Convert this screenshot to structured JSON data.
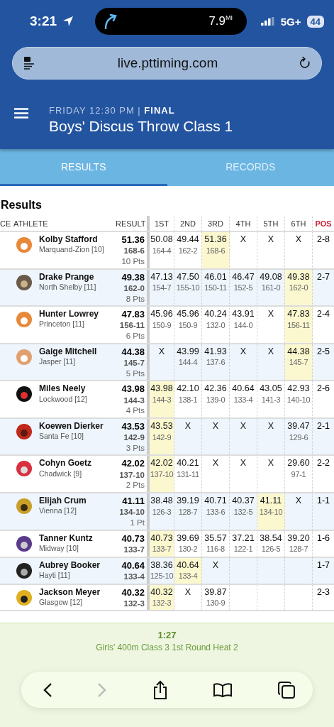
{
  "status_bar": {
    "time": "3:21",
    "activity": "7.9$^{MI}$",
    "network": "5G+",
    "battery": "44"
  },
  "browser": {
    "url": "live.pttiming.com"
  },
  "header": {
    "subtitle": "FRIDAY 12:30 PM | **FINAL**",
    "title": "Boys' Discus Throw Class 1"
  },
  "tabs": [
    {
      "label": "RESULTS",
      "selected": true
    },
    {
      "label": "RECORDS",
      "selected": false
    }
  ],
  "section_title": "Results",
  "table": {
    "columns": [
      {
        "label": "CE",
        "kind": "place"
      },
      {
        "label": "ATHLETE",
        "kind": "athlete"
      },
      {
        "label": "RESULT",
        "kind": "result"
      },
      {
        "label": "1ST",
        "kind": "attempt"
      },
      {
        "label": "2ND",
        "kind": "attempt"
      },
      {
        "label": "3RD",
        "kind": "attempt"
      },
      {
        "label": "4TH",
        "kind": "attempt"
      },
      {
        "label": "5TH",
        "kind": "attempt"
      },
      {
        "label": "6TH",
        "kind": "attempt"
      },
      {
        "label": "POS",
        "kind": "position"
      }
    ],
    "rows": [
      {
        "name": "Kolby Stafford",
        "school": "Marquand-Zion [10]",
        "mark": "51.36",
        "feet": "168-6",
        "points": "10 Pts",
        "attempts": [
          {
            "mark": "50.08",
            "feet": "164-4",
            "best": false
          },
          {
            "mark": "49.44",
            "feet": "162-2",
            "best": false
          },
          {
            "mark": "51.36",
            "feet": "168-6",
            "best": true
          },
          {
            "mark": "X",
            "best": false
          },
          {
            "mark": "X",
            "best": false
          },
          {
            "mark": "X",
            "best": false
          }
        ],
        "pos": "2-8"
      },
      {
        "name": "Drake Prange",
        "school": "North Shelby [11]",
        "mark": "49.38",
        "feet": "162-0",
        "points": "8 Pts",
        "attempts": [
          {
            "mark": "47.13",
            "feet": "154-7",
            "best": false
          },
          {
            "mark": "47.50",
            "feet": "155-10",
            "best": false
          },
          {
            "mark": "46.01",
            "feet": "150-11",
            "best": false
          },
          {
            "mark": "46.47",
            "feet": "152-5",
            "best": false
          },
          {
            "mark": "49.08",
            "feet": "161-0",
            "best": false
          },
          {
            "mark": "49.38",
            "feet": "162-0",
            "best": true
          }
        ],
        "pos": "2-7"
      },
      {
        "name": "Hunter Lowrey",
        "school": "Princeton [11]",
        "mark": "47.83",
        "feet": "156-11",
        "points": "6 Pts",
        "attempts": [
          {
            "mark": "45.96",
            "feet": "150-9",
            "best": false
          },
          {
            "mark": "45.96",
            "feet": "150-9",
            "best": false
          },
          {
            "mark": "40.24",
            "feet": "132-0",
            "best": false
          },
          {
            "mark": "43.91",
            "feet": "144-0",
            "best": false
          },
          {
            "mark": "X",
            "best": false
          },
          {
            "mark": "47.83",
            "feet": "156-11",
            "best": true
          }
        ],
        "pos": "2-4"
      },
      {
        "name": "Gaige Mitchell",
        "school": "Jasper [11]",
        "mark": "44.38",
        "feet": "145-7",
        "points": "5 Pts",
        "attempts": [
          {
            "mark": "X",
            "best": false
          },
          {
            "mark": "43.99",
            "feet": "144-4",
            "best": false
          },
          {
            "mark": "41.93",
            "feet": "137-6",
            "best": false
          },
          {
            "mark": "X",
            "best": false
          },
          {
            "mark": "X",
            "best": false
          },
          {
            "mark": "44.38",
            "feet": "145-7",
            "best": true
          }
        ],
        "pos": "2-5"
      },
      {
        "name": "Miles Neely",
        "school": "Lockwood [12]",
        "mark": "43.98",
        "feet": "144-3",
        "points": "4 Pts",
        "attempts": [
          {
            "mark": "43.98",
            "feet": "144-3",
            "best": true
          },
          {
            "mark": "42.10",
            "feet": "138-1",
            "best": false
          },
          {
            "mark": "42.36",
            "feet": "139-0",
            "best": false
          },
          {
            "mark": "40.64",
            "feet": "133-4",
            "best": false
          },
          {
            "mark": "43.05",
            "feet": "141-3",
            "best": false
          },
          {
            "mark": "42.93",
            "feet": "140-10",
            "best": false
          }
        ],
        "pos": "2-6"
      },
      {
        "name": "Koewen Dierker",
        "school": "Santa Fe [10]",
        "mark": "43.53",
        "feet": "142-9",
        "points": "3 Pts",
        "attempts": [
          {
            "mark": "43.53",
            "feet": "142-9",
            "best": true
          },
          {
            "mark": "X",
            "best": false
          },
          {
            "mark": "X",
            "best": false
          },
          {
            "mark": "X",
            "best": false
          },
          {
            "mark": "X",
            "best": false
          },
          {
            "mark": "39.47",
            "feet": "129-6",
            "best": false
          }
        ],
        "pos": "2-1"
      },
      {
        "name": "Cohyn Goetz",
        "school": "Chadwick [9]",
        "mark": "42.02",
        "feet": "137-10",
        "points": "2 Pts",
        "attempts": [
          {
            "mark": "42.02",
            "feet": "137-10",
            "best": true
          },
          {
            "mark": "40.21",
            "feet": "131-11",
            "best": false
          },
          {
            "mark": "X",
            "best": false
          },
          {
            "mark": "X",
            "best": false
          },
          {
            "mark": "X",
            "best": false
          },
          {
            "mark": "29.60",
            "feet": "97-1",
            "best": false
          }
        ],
        "pos": "2-2"
      },
      {
        "name": "Elijah Crum",
        "school": "Vienna [12]",
        "mark": "41.11",
        "feet": "134-10",
        "points": "1 Pt",
        "attempts": [
          {
            "mark": "38.48",
            "feet": "126-3",
            "best": false
          },
          {
            "mark": "39.19",
            "feet": "128-7",
            "best": false
          },
          {
            "mark": "40.71",
            "feet": "133-6",
            "best": false
          },
          {
            "mark": "40.37",
            "feet": "132-5",
            "best": false
          },
          {
            "mark": "41.11",
            "feet": "134-10",
            "best": true
          },
          {
            "mark": "X",
            "best": false
          }
        ],
        "pos": "1-1"
      },
      {
        "name": "Tanner Kuntz",
        "school": "Midway [10]",
        "mark": "40.73",
        "feet": "133-7",
        "attempts": [
          {
            "mark": "40.73",
            "feet": "133-7",
            "best": true
          },
          {
            "mark": "39.69",
            "feet": "130-2",
            "best": false
          },
          {
            "mark": "35.57",
            "feet": "116-8",
            "best": false
          },
          {
            "mark": "37.21",
            "feet": "122-1",
            "best": false
          },
          {
            "mark": "38.54",
            "feet": "126-5",
            "best": false
          },
          {
            "mark": "39.20",
            "feet": "128-7",
            "best": false
          }
        ],
        "pos": "1-6"
      },
      {
        "name": "Aubrey Booker",
        "school": "Hayti [11]",
        "mark": "40.64",
        "feet": "133-4",
        "attempts": [
          {
            "mark": "38.36",
            "feet": "125-10",
            "best": false
          },
          {
            "mark": "40.64",
            "feet": "133-4",
            "best": true
          },
          {
            "mark": "X",
            "best": false
          }
        ],
        "pos": "1-7"
      },
      {
        "name": "Jackson Meyer",
        "school": "Glasgow [12]",
        "mark": "40.32",
        "feet": "132-3",
        "attempts": [
          {
            "mark": "40.32",
            "feet": "132-3",
            "best": true
          },
          {
            "mark": "X",
            "best": false
          },
          {
            "mark": "39.87",
            "feet": "130-9",
            "best": false
          }
        ],
        "pos": "2-3"
      }
    ]
  },
  "next_event": {
    "time": "1:27",
    "name": "Girls' 400m Class 3 1st Round Heat 2"
  }
}
